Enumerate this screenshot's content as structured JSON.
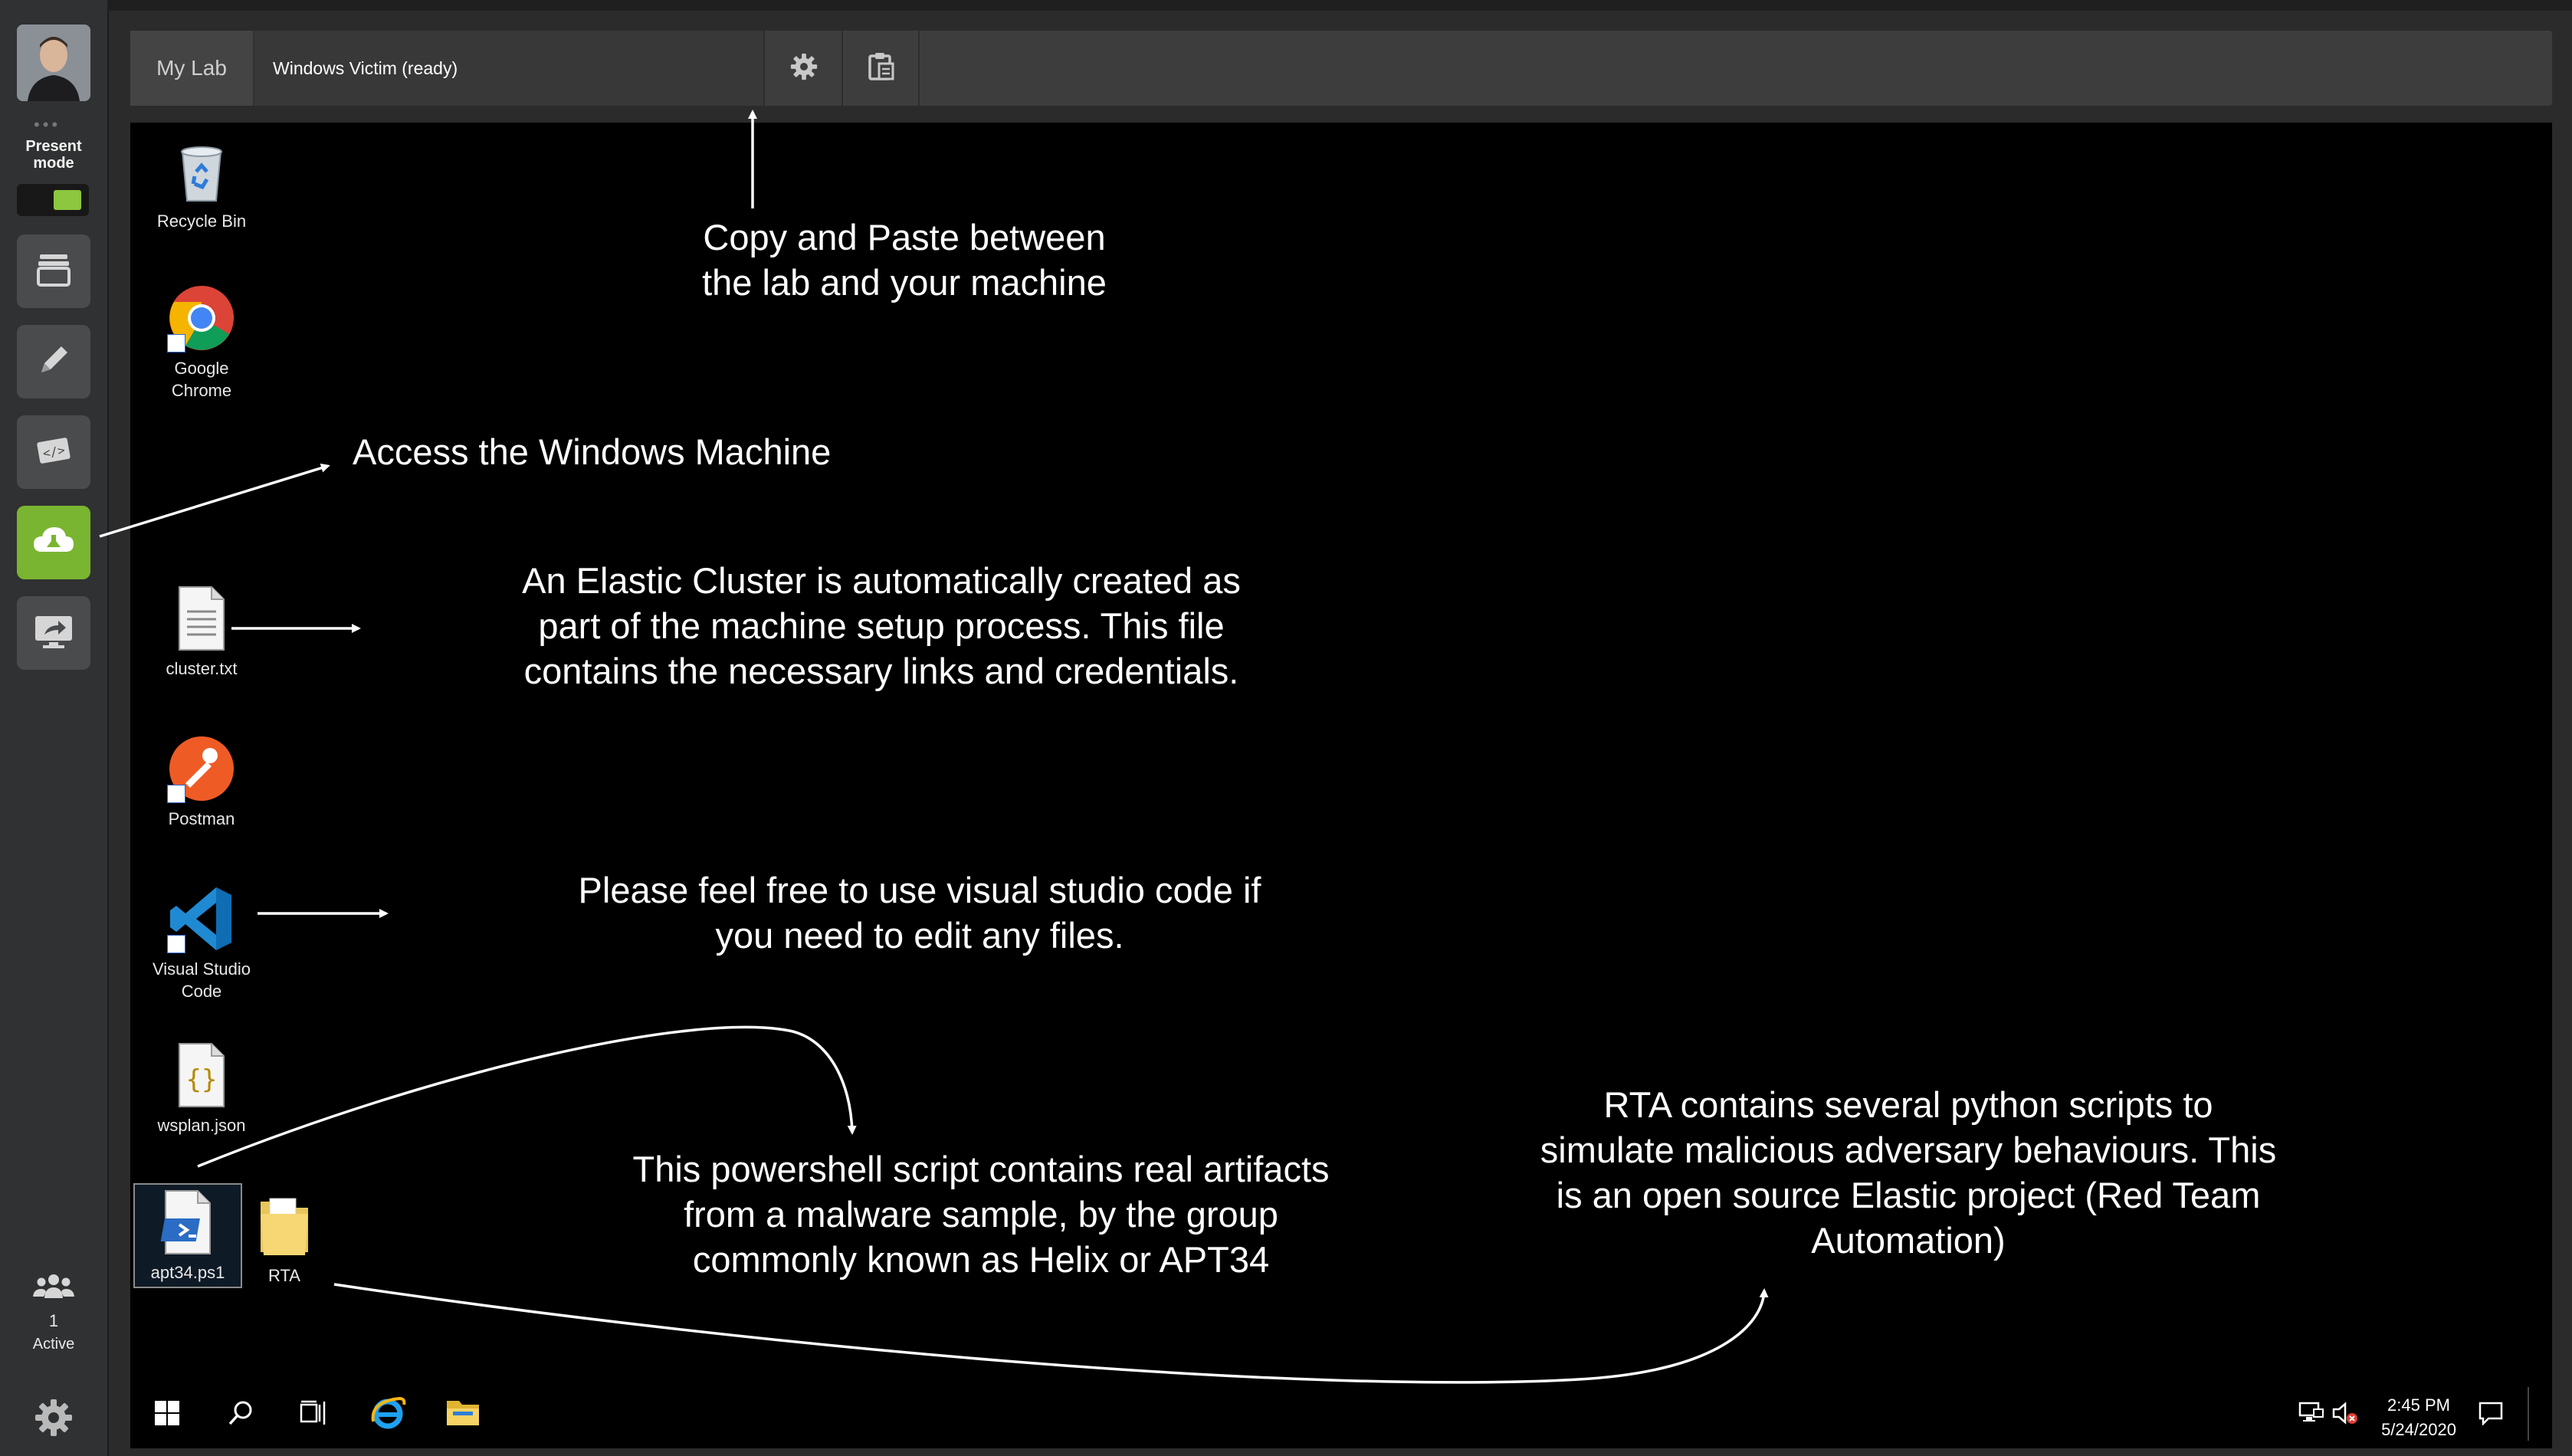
{
  "sidebar": {
    "present_label": "Present\nmode",
    "active_count": "1",
    "active_label": "Active",
    "accent_color": "#79b531"
  },
  "topbar": {
    "lab_tab": "My Lab",
    "machine_tab": "Windows Victim (ready)"
  },
  "desktop_icons": {
    "recycle_bin": "Recycle Bin",
    "chrome_line1": "Google",
    "chrome_line2": "Chrome",
    "cluster": "cluster.txt",
    "postman": "Postman",
    "vscode_line1": "Visual Studio",
    "vscode_line2": "Code",
    "wsplan": "wsplan.json",
    "apt34": "apt34.ps1",
    "rta": "RTA"
  },
  "notes": {
    "copy_paste_line1": "Copy and Paste between",
    "copy_paste_line2": "the lab and your machine",
    "access": "Access the Windows Machine",
    "cluster_line1": "An Elastic Cluster is automatically created as",
    "cluster_line2": "part of the machine setup process. This file",
    "cluster_line3": "contains the necessary links and credentials.",
    "vscode_line1": "Please feel free to use visual studio code if",
    "vscode_line2": "you need to edit any files.",
    "powershell_line1": "This powershell script contains real artifacts",
    "powershell_line2": "from a malware sample, by the group",
    "powershell_line3": "commonly known as Helix or APT34",
    "rta_line1": "RTA contains several python scripts to",
    "rta_line2": "simulate malicious adversary behaviours. This",
    "rta_line3": "is an open source Elastic project (Red Team",
    "rta_line4": "Automation)"
  },
  "taskbar": {
    "time": "2:45 PM",
    "date": "5/24/2020"
  }
}
